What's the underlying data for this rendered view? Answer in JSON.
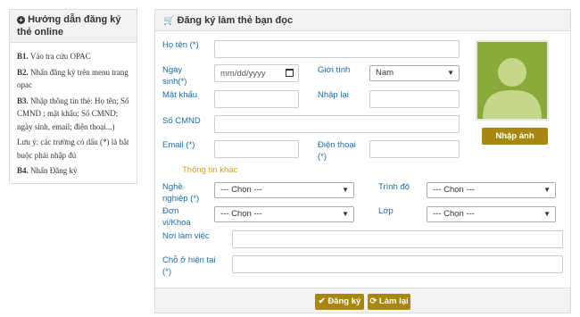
{
  "sidebar": {
    "title": "Hướng dẫn đăng ký thẻ online",
    "title_icon": "plus-circle-icon",
    "steps": [
      {
        "bold": "B1.",
        "text": " Vào tra cứu OPAC"
      },
      {
        "bold": "B2.",
        "text": " Nhấn đăng ký trên menu trang opac"
      },
      {
        "bold": "B3.",
        "text": " Nhập thông tin thẻ: Họ tên; Số CMND ; mật khẩu; Số CMND; ngày sinh, email; điện thoại...)"
      },
      {
        "bold": "",
        "text": "Lưu ý: các trường có dấu (*) là bắt buộc phải nhập đủ"
      },
      {
        "bold": "B4.",
        "text": " Nhấn Đăng ký"
      }
    ]
  },
  "form": {
    "title": "Đăng ký làm thẻ bạn đọc",
    "title_icon": "cart-icon",
    "labels": {
      "fullname": "Họ tên (*)",
      "dob": "Ngày sinh(*)",
      "gender": "Giới tính",
      "password": "Mật khẩu",
      "repassword": "Nhập lại",
      "cmnd": "Số CMND",
      "email": "Email (*)",
      "phone": "Điện thoại (*)",
      "other_info": "Thông tin khác",
      "job": "Nghề nghiệp (*)",
      "level": "Trình độ",
      "unit": "Đơn vị/Khoa",
      "class": "Lớp",
      "workplace": "Nơi làm việc",
      "address": "Chỗ ở hiện tại (*)"
    },
    "values": {
      "dob_placeholder": "mm/dd/yyyy",
      "gender": "Nam",
      "job": "--- Chọn ---",
      "level": "--- Chọn ---",
      "unit": "--- Chọn ---",
      "class": "--- Chọn ---"
    },
    "upload_button": "Nhập ảnh",
    "submit_button": "Đăng ký",
    "reset_button": "Làm lại",
    "colors": {
      "accent": "#a8870f",
      "label": "#1a6ca8",
      "section": "#d4a017"
    }
  }
}
